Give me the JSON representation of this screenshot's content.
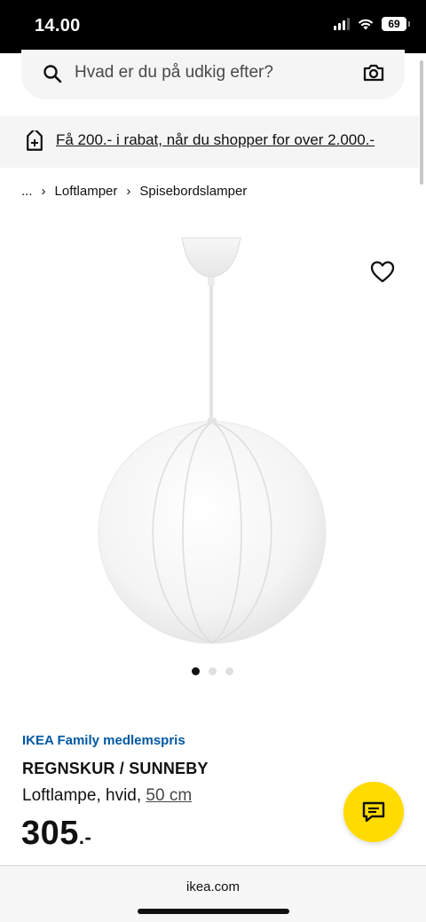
{
  "status_bar": {
    "time": "14.00",
    "battery": "69"
  },
  "search": {
    "placeholder": "Hvad er du på udkig efter?"
  },
  "promo": {
    "text": "Få 200.- i rabat, når du shopper for over 2.000.-"
  },
  "breadcrumb": {
    "items": [
      "...",
      "Loftlamper",
      "Spisebordslamper"
    ]
  },
  "carousel": {
    "count": 3,
    "active_index": 0
  },
  "product": {
    "family_label": "IKEA Family medlemspris",
    "name": "REGNSKUR / SUNNEBY",
    "description": "Loftlampe, hvid, ",
    "size_link": "50 cm",
    "price": "305",
    "price_suffix": ".-"
  },
  "browser": {
    "url": "ikea.com"
  },
  "colors": {
    "brand_blue": "#0058a3",
    "chat_yellow": "#ffdb00",
    "banner_bg": "#f5f5f5"
  },
  "icons": [
    "search-icon",
    "camera-icon",
    "tag-icon",
    "heart-icon",
    "chat-icon"
  ]
}
